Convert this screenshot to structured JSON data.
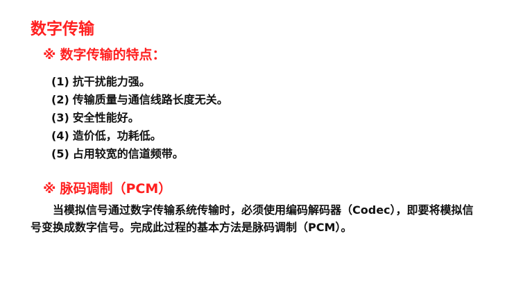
{
  "title": "数字传输",
  "section1": {
    "mark": "※",
    "heading": "数字传输的特点："
  },
  "features": [
    {
      "num": "(1)",
      "text": "抗干扰能力强。"
    },
    {
      "num": "(2)",
      "text": "传输质量与通信线路长度无关。"
    },
    {
      "num": "(3)",
      "text": "安全性能好。"
    },
    {
      "num": "(4)",
      "text": "造价低，功耗低。"
    },
    {
      "num": "(5)",
      "text": "占用较宽的信道频带。"
    }
  ],
  "section2": {
    "mark": "※",
    "heading": "脉码调制（PCM）"
  },
  "paragraph": "当模拟信号通过数字传输系统传输时，必须使用编码解码器（Codec），即要将模拟信号变换成数字信号。完成此过程的基本方法是脉码调制（PCM）。",
  "colors": {
    "heading": "#ff1f1f",
    "text": "#111111",
    "background": "#ffffff"
  }
}
